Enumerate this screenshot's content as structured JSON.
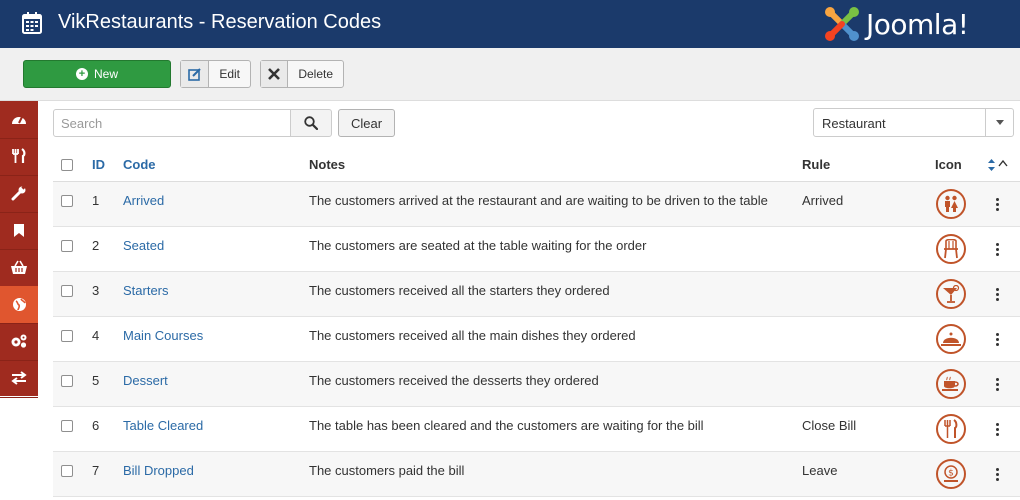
{
  "header": {
    "title": "VikRestaurants - Reservation Codes",
    "logo_text": "Joomla!"
  },
  "toolbar": {
    "new_label": "New",
    "edit_label": "Edit",
    "delete_label": "Delete"
  },
  "sidebar": {
    "items": [
      {
        "icon": "dashboard-icon"
      },
      {
        "icon": "restaurant-icon"
      },
      {
        "icon": "wrench-icon"
      },
      {
        "icon": "bookmark-icon"
      },
      {
        "icon": "basket-icon"
      },
      {
        "icon": "globe-icon",
        "active": true
      },
      {
        "icon": "gears-icon"
      },
      {
        "icon": "exchange-icon"
      }
    ]
  },
  "filters": {
    "search_placeholder": "Search",
    "clear_label": "Clear",
    "type_value": "Restaurant"
  },
  "table": {
    "headers": {
      "id": "ID",
      "code": "Code",
      "notes": "Notes",
      "rule": "Rule",
      "icon": "Icon"
    },
    "rows": [
      {
        "id": "1",
        "code": "Arrived",
        "notes": "The customers arrived at the restaurant and are waiting to be driven to the table",
        "rule": "Arrived",
        "icon": "family-icon"
      },
      {
        "id": "2",
        "code": "Seated",
        "notes": "The customers are seated at the table waiting for the order",
        "rule": "",
        "icon": "chair-icon"
      },
      {
        "id": "3",
        "code": "Starters",
        "notes": "The customers received all the starters they ordered",
        "rule": "",
        "icon": "cocktail-icon"
      },
      {
        "id": "4",
        "code": "Main Courses",
        "notes": "The customers received all the main dishes they ordered",
        "rule": "",
        "icon": "cloche-icon"
      },
      {
        "id": "5",
        "code": "Dessert",
        "notes": "The customers received the desserts they ordered",
        "rule": "",
        "icon": "coffee-cup-icon"
      },
      {
        "id": "6",
        "code": "Table Cleared",
        "notes": "The table has been cleared and the customers are waiting for the bill",
        "rule": "Close Bill",
        "icon": "cutlery-icon"
      },
      {
        "id": "7",
        "code": "Bill Dropped",
        "notes": "The customers paid the bill",
        "rule": "Leave",
        "icon": "money-icon"
      }
    ]
  },
  "colors": {
    "header_bg": "#1b3a6b",
    "sidebar_bg": "#9f2b1f",
    "sidebar_active": "#e0562f",
    "new_button": "#2f9a41",
    "link": "#2b6aa6",
    "icon_accent": "#c0542a"
  }
}
